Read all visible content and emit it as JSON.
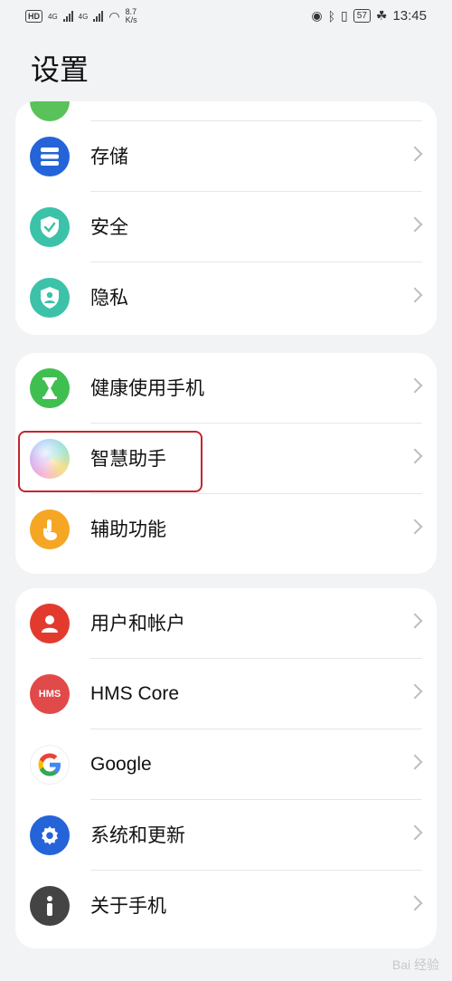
{
  "status_bar": {
    "hd": "HD",
    "sim1_net": "4G",
    "sim2_net": "4G",
    "speed_value": "8.7",
    "speed_unit": "K/s",
    "battery": "57",
    "time": "13:45"
  },
  "page_title": "设置",
  "cards": [
    {
      "items": [
        {
          "label": "存储",
          "icon": "storage-icon",
          "color": "#2563d9"
        },
        {
          "label": "安全",
          "icon": "shield-check-icon",
          "color": "#3cc2a8"
        },
        {
          "label": "隐私",
          "icon": "privacy-shield-icon",
          "color": "#3cc2a8"
        }
      ]
    },
    {
      "items": [
        {
          "label": "健康使用手机",
          "icon": "hourglass-icon",
          "color": "#3fbf4f"
        },
        {
          "label": "智慧助手",
          "icon": "celia-orb-icon",
          "color": "#c9a3f0"
        },
        {
          "label": "辅助功能",
          "icon": "hand-pointer-icon",
          "color": "#f5a623"
        }
      ]
    },
    {
      "items": [
        {
          "label": "用户和帐户",
          "icon": "user-icon",
          "color": "#e23b2e"
        },
        {
          "label": "HMS Core",
          "icon": "hms-icon",
          "color": "#e24a4a"
        },
        {
          "label": "Google",
          "icon": "google-icon",
          "color": "#ffffff"
        },
        {
          "label": "系统和更新",
          "icon": "gear-icon",
          "color": "#2563d9"
        },
        {
          "label": "关于手机",
          "icon": "info-icon",
          "color": "#444444"
        }
      ]
    }
  ],
  "hms_icon_text": "HMS",
  "watermark": "Bai 经验"
}
